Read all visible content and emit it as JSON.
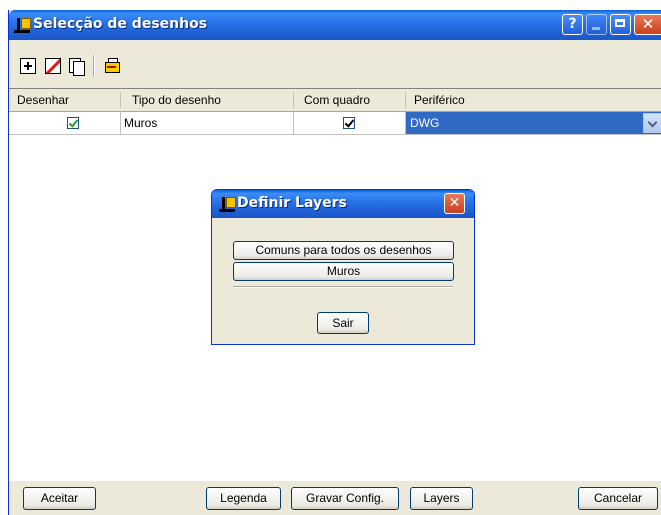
{
  "window": {
    "title": "Selecção de desenhos",
    "controls": {
      "help": "?",
      "close": "✕"
    }
  },
  "toolbar": {
    "icons": [
      "add-drawing-icon",
      "delete-drawing-icon",
      "copy-drawing-icon",
      "layers-icon"
    ]
  },
  "grid": {
    "columns": [
      "Desenhar",
      "Tipo do desenho",
      "Com quadro",
      "Periférico"
    ],
    "rows": [
      {
        "desenhar": true,
        "tipo": "Muros",
        "com_quadro": true,
        "periferico": "DWG"
      }
    ]
  },
  "footer": {
    "accept": "Aceitar",
    "legend": "Legenda",
    "save_config": "Gravar Config.",
    "layers": "Layers",
    "cancel": "Cancelar"
  },
  "dialog": {
    "title": "Definir Layers",
    "close": "✕",
    "options": [
      "Comuns para todos os desenhos",
      "Muros"
    ],
    "exit": "Sair"
  },
  "colors": {
    "titlebar": "#2a74ea",
    "selection": "#316ac5",
    "face": "#ece9d8"
  }
}
